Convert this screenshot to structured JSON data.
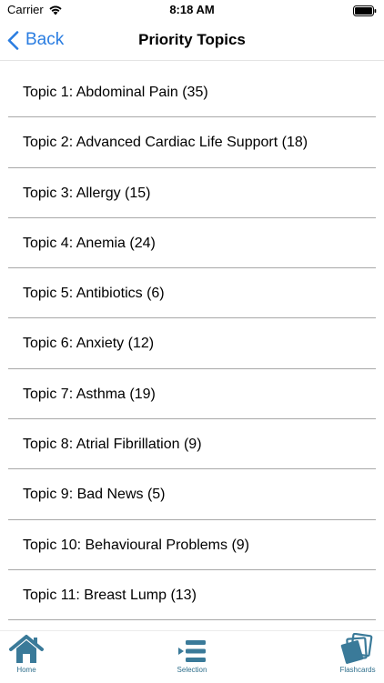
{
  "status_bar": {
    "carrier": "Carrier",
    "time": "8:18 AM"
  },
  "nav": {
    "back_label": "Back",
    "title": "Priority Topics"
  },
  "topics": [
    "Topic 1: Abdominal Pain (35)",
    "Topic 2: Advanced Cardiac Life Support (18)",
    "Topic 3: Allergy (15)",
    "Topic 4: Anemia (24)",
    "Topic 5: Antibiotics (6)",
    "Topic 6: Anxiety (12)",
    "Topic 7: Asthma (19)",
    "Topic 8: Atrial Fibrillation (9)",
    "Topic 9: Bad News (5)",
    "Topic 10: Behavioural Problems (9)",
    "Topic 11: Breast Lump (13)"
  ],
  "tab_bar": {
    "home_label": "Home",
    "selection_label": "Selection",
    "flashcards_label": "Flashcards"
  },
  "icons": {
    "wifi": "wifi-icon",
    "battery": "battery-icon",
    "back": "chevron-left-icon",
    "home": "home-icon",
    "selection": "list-selection-icon",
    "flashcards": "flashcards-icon"
  },
  "colors": {
    "accent": "#2a7de1",
    "tab_icon": "#3a7a99",
    "separator": "#a8a8a8"
  }
}
